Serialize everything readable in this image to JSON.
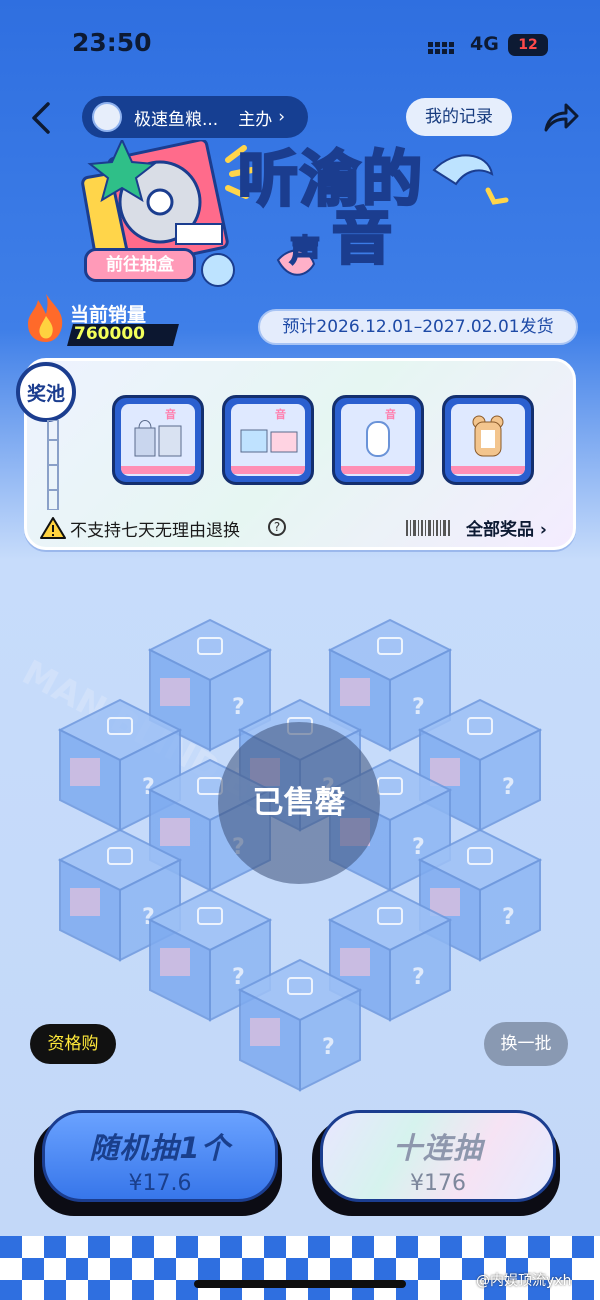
{
  "status_bar": {
    "time": "23:50",
    "network": "4G",
    "battery": "12"
  },
  "nav": {
    "shop_name": "极速鱼粮...",
    "shop_role": "主办",
    "records_label": "我的记录"
  },
  "banner": {
    "goto_label": "前往抽盒",
    "title_line1": "听渝的",
    "title_line2": "音",
    "title_small": "声"
  },
  "sales": {
    "label": "当前销量",
    "value": "760000"
  },
  "shipping": {
    "text": "预计2026.12.01–2027.02.01发货"
  },
  "prize_pool": {
    "badge": "奖池",
    "warning": "不支持七天无理由退换",
    "help": "?",
    "all_prizes_label": "全部奖品 ›"
  },
  "boxes": {
    "sold_out_label": "已售罄"
  },
  "actions": {
    "qualification_label": "资格购",
    "swap_label": "换一批",
    "draw_one_label": "随机抽1个",
    "draw_one_price": "¥17.6",
    "draw_ten_label": "十连抽",
    "draw_ten_price": "¥176"
  },
  "watermark": "@内娱顶流yxh",
  "colors": {
    "primary": "#2f6fe0",
    "accent_pink": "#ff7fae",
    "dark_navy": "#1b3d8f",
    "sales_yellow": "#f3ff5a"
  }
}
